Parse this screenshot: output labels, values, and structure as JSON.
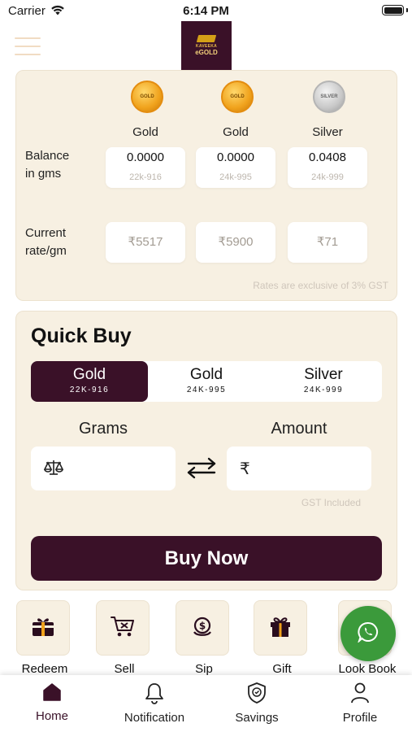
{
  "status_bar": {
    "carrier": "Carrier",
    "time": "6:14 PM"
  },
  "header": {
    "logo_line1": "KAVEEKA",
    "logo_line2": "eGOLD"
  },
  "balance": {
    "metals": [
      {
        "name": "Gold",
        "coin_text": "GOLD",
        "balance": "0.0000",
        "purity": "22k-916",
        "rate": "₹5517"
      },
      {
        "name": "Gold",
        "coin_text": "GOLD",
        "balance": "0.0000",
        "purity": "24k-995",
        "rate": "₹5900"
      },
      {
        "name": "Silver",
        "coin_text": "SILVER",
        "balance": "0.0408",
        "purity": "24k-999",
        "rate": "₹71"
      }
    ],
    "balance_label": [
      "Balance",
      "in gms"
    ],
    "rate_label": [
      "Current",
      "rate/gm"
    ],
    "gst_note": "Rates are exclusive of 3% GST"
  },
  "quick_buy": {
    "title": "Quick Buy",
    "options": [
      {
        "name": "Gold",
        "purity": "22K-916"
      },
      {
        "name": "Gold",
        "purity": "24K-995"
      },
      {
        "name": "Silver",
        "purity": "24K-999"
      }
    ],
    "selected_index": 0,
    "grams_label": "Grams",
    "amount_label": "Amount",
    "grams_value": "",
    "amount_value": "",
    "currency_symbol": "₹",
    "gst_included": "GST Included",
    "buy_label": "Buy Now"
  },
  "actions": [
    {
      "label": "Redeem",
      "icon": "redeem-icon"
    },
    {
      "label": "Sell",
      "icon": "sell-cart-icon"
    },
    {
      "label": "Sip",
      "icon": "sip-coin-icon"
    },
    {
      "label": "Gift",
      "icon": "gift-icon"
    },
    {
      "label": "Look Book",
      "icon": "look-book-icon"
    }
  ],
  "bottom_nav": [
    {
      "label": "Home",
      "icon": "home-icon",
      "active": true
    },
    {
      "label": "Notification",
      "icon": "bell-icon",
      "active": false
    },
    {
      "label": "Savings",
      "icon": "shield-icon",
      "active": false
    },
    {
      "label": "Profile",
      "icon": "person-icon",
      "active": false
    }
  ],
  "colors": {
    "brand": "#3a1128",
    "card_bg": "#f7f0e2",
    "whatsapp": "#3b9a3b",
    "gold": "#f0a21c"
  }
}
